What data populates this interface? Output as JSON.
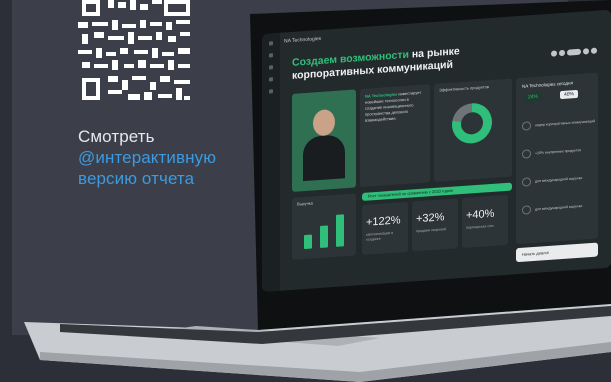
{
  "cta": {
    "line1": "Смотреть",
    "line2": "@интерактивную",
    "line3": "версию отчета"
  },
  "screen": {
    "brand": "NA Technologies",
    "hero_accent": "Создаем возможности",
    "hero_rest_1": " на рынке",
    "hero_rest_2": "корпоративных коммуникаций",
    "intro_brand": "NA Technologies",
    "intro_text": "инвестирует новейшие технологии в создание инновационного пространства делового взаимодействия.",
    "donut_title": "Эффективность продуктов",
    "banner_text": "Рост показателей по сравнению с 2023 годом",
    "bars_title": "Выручка",
    "stats": [
      {
        "value": "+122%",
        "caption": "капитализация в холдинге"
      },
      {
        "value": "+32%",
        "caption": "продажи лицензий"
      },
      {
        "value": "+40%",
        "caption": "партнерская сеть"
      }
    ],
    "right_title": "NA Technologies сегодня",
    "right_pcts": [
      "24%",
      "40%"
    ],
    "right_list": [
      "лидер корпоративных коммуникаций",
      "+20% внутренних продуктов",
      "для международной выручки",
      "для международной выручки"
    ],
    "button_label": "Начать диалог"
  },
  "colors": {
    "accent": "#2fbf7a",
    "link": "#3b9be0",
    "background": "#2c2f38"
  }
}
